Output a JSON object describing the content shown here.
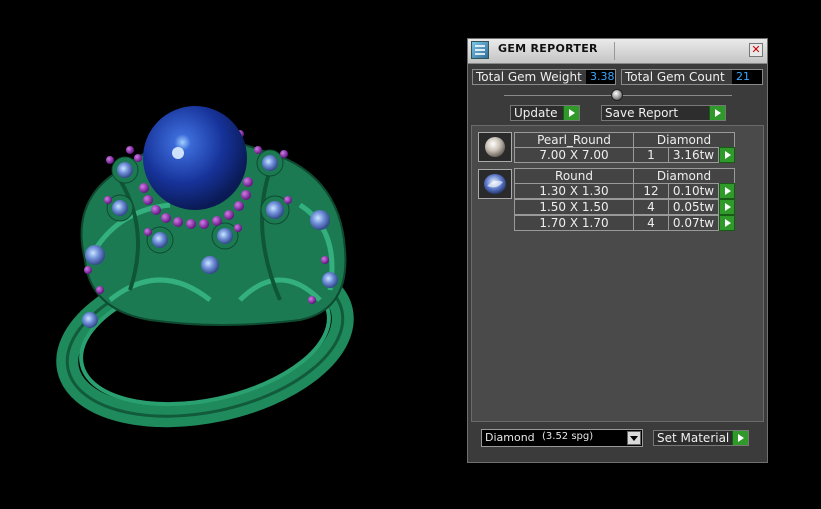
{
  "panel": {
    "title": "GEM REPORTER",
    "close_glyph": "✕",
    "total_weight_label": "Total Gem Weight",
    "total_weight_value": "3.38",
    "total_count_label": "Total Gem Count",
    "total_count_value": "21",
    "update_label": "Update",
    "save_report_label": "Save Report"
  },
  "groups": [
    {
      "thumb": "pearl",
      "header": [
        "Pearl_Round",
        "Diamond"
      ],
      "rows": [
        {
          "size": "7.00 X 7.00",
          "count": "1",
          "weight": "3.16tw"
        }
      ]
    },
    {
      "thumb": "round-gem",
      "header": [
        "Round",
        "Diamond"
      ],
      "rows": [
        {
          "size": "1.30 X 1.30",
          "count": "12",
          "weight": "0.10tw"
        },
        {
          "size": "1.50 X 1.50",
          "count": "4",
          "weight": "0.05tw"
        },
        {
          "size": "1.70 X 1.70",
          "count": "4",
          "weight": "0.07tw"
        }
      ]
    }
  ],
  "material": {
    "name": "Diamond",
    "spg": "(3.52 spg)",
    "set_label": "Set Material"
  },
  "colors": {
    "accent_green": "#2f9a2a",
    "value_blue": "#38a8ff",
    "ring_green": "#1f8a5c",
    "pearl_blue": "#1c3f9c",
    "bead_purple": "#7a1fa0"
  }
}
